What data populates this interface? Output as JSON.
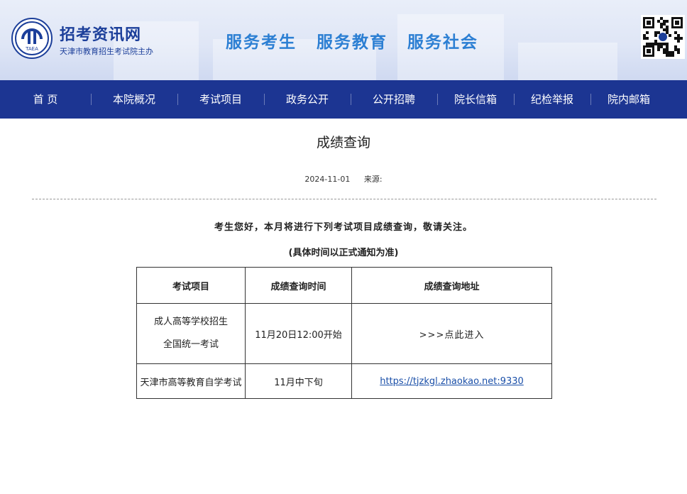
{
  "header": {
    "site_name": "招考资讯网",
    "site_sub": "天津市教育招生考试院主办",
    "logo_text": "TAEA",
    "slogans": [
      "服务考生",
      "服务教育",
      "服务社会"
    ],
    "brand_color": "#1c3f9a",
    "slogan_color": "#2c7fd3"
  },
  "nav": {
    "items": [
      "首 页",
      "本院概况",
      "考试项目",
      "政务公开",
      "公开招聘",
      "院长信箱",
      "纪检举报",
      "院内邮箱"
    ],
    "bg_color": "#1c3592"
  },
  "article": {
    "title": "成绩查询",
    "date": "2024-11-01",
    "source_label": "来源:",
    "notice": "考生您好，本月将进行下列考试项目成绩查询，敬请关注。",
    "notice_sub": "(具体时间以正式通知为准)"
  },
  "table": {
    "headers": [
      "考试项目",
      "成绩查询时间",
      "成绩查询地址"
    ],
    "rows": [
      {
        "project_line1": "成人高等学校招生",
        "project_line2": "全国统一考试",
        "time": "11月20日12:00开始",
        "address": ">>>点此进入"
      },
      {
        "project": "天津市高等教育自学考试",
        "time": "11月中下旬",
        "address": "https://tjzkgl.zhaokao.net:9330"
      }
    ]
  }
}
